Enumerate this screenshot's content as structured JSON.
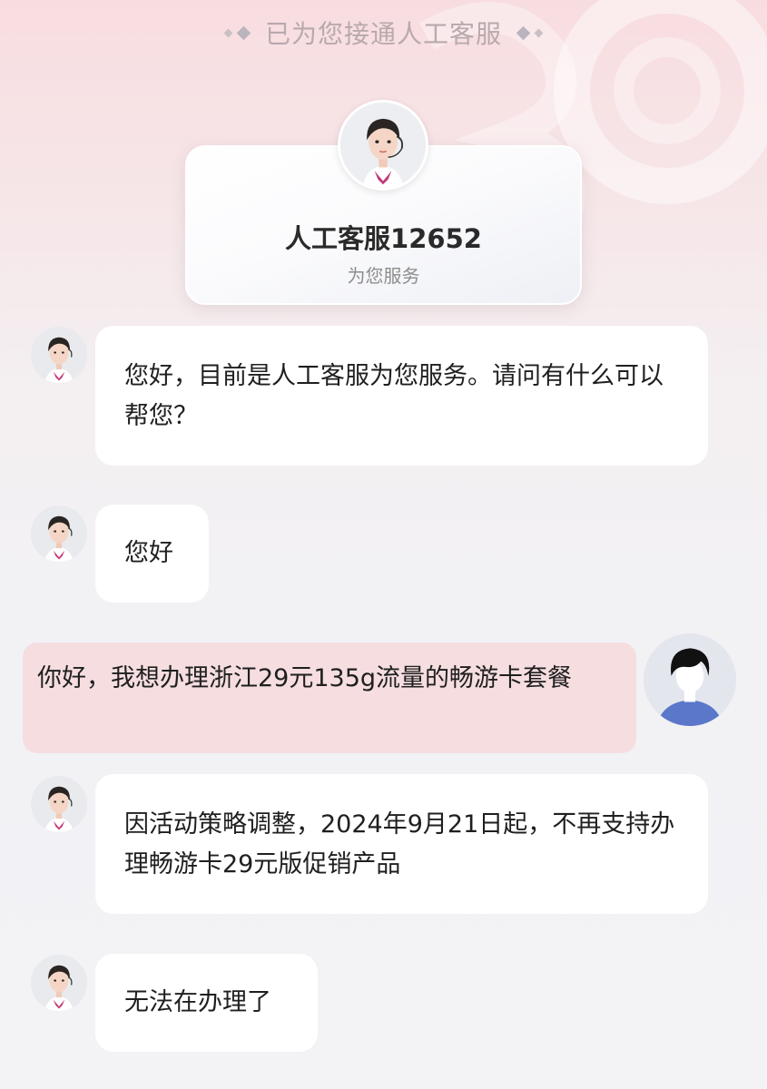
{
  "banner": {
    "text": "已为您接通人工客服"
  },
  "agent_card": {
    "title": "人工客服12652",
    "subtitle": "为您服务"
  },
  "messages": [
    {
      "sender": "agent",
      "text": "您好，目前是人工客服为您服务。请问有什么可以帮您？"
    },
    {
      "sender": "agent",
      "text": "您好"
    },
    {
      "sender": "user",
      "text": "你好，我想办理浙江29元135g流量的畅游卡套餐"
    },
    {
      "sender": "agent",
      "text": "因活动策略调整，2024年9月21日起，不再支持办理畅游卡29元版促销产品"
    },
    {
      "sender": "agent",
      "text": "无法在办理了"
    }
  ],
  "colors": {
    "user_bubble": "#f5dde0",
    "agent_bubble": "#ffffff",
    "user_avatar_shirt": "#5a77c9"
  },
  "icons": {
    "agent_avatar": "female-customer-service-agent-with-headset",
    "user_avatar": "default-user-silhouette"
  }
}
